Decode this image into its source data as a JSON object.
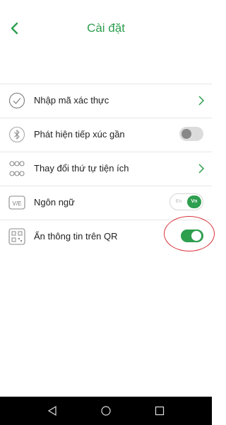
{
  "header": {
    "title": "Cài đặt"
  },
  "colors": {
    "accent": "#2e9e4f",
    "annotation": "#d9363e"
  },
  "settings": [
    {
      "label": "Nhập mã xác thực",
      "icon": "check-circle-icon",
      "control": "chevron"
    },
    {
      "label": "Phát hiện tiếp xúc gần",
      "icon": "bluetooth-icon",
      "control": "toggle",
      "enabled": false
    },
    {
      "label": "Thay đổi thứ tự tiện ích",
      "icon": "grid-icon",
      "control": "chevron"
    },
    {
      "label": "Ngôn ngữ",
      "icon": "language-icon",
      "icon_text": "V/E",
      "control": "language",
      "options": [
        "En",
        "Vn"
      ],
      "selected": "Vn"
    },
    {
      "label": "Ẩn thông tin trên QR",
      "icon": "qr-code-icon",
      "control": "toggle",
      "enabled": true
    }
  ],
  "navbar": {
    "buttons": [
      "back-icon",
      "home-icon",
      "recents-icon"
    ]
  }
}
